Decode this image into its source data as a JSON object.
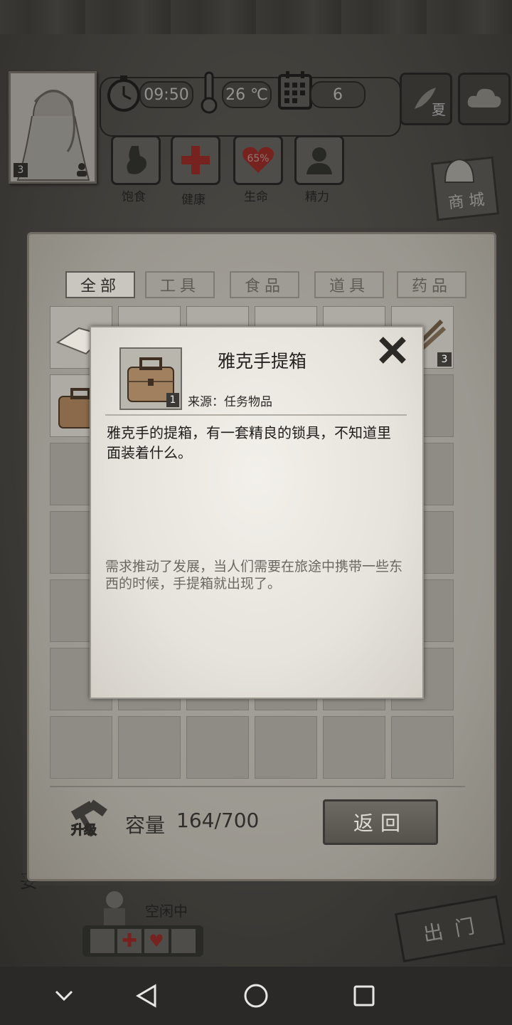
{
  "hud": {
    "time": "09:50",
    "temperature": "26 ℃",
    "day": "6",
    "season": "夏",
    "character_level": "3"
  },
  "stats": [
    {
      "label": "饱食"
    },
    {
      "label": "健康"
    },
    {
      "label": "生命",
      "value": "65%"
    },
    {
      "label": "精力"
    }
  ],
  "shop_label": "商 城",
  "inventory": {
    "tabs": [
      "全部",
      "工具",
      "食品",
      "道具",
      "药品"
    ],
    "active_tab": 0,
    "slot_count_badge": "3",
    "capacity_label": "容量",
    "capacity_value": "164/700",
    "upgrade_label": "升级",
    "return_label": "返回"
  },
  "item_dialog": {
    "title": "雅克手提箱",
    "quantity": "1",
    "source": "来源：任务物品",
    "description": "雅克手的提箱，有一套精良的锁具，不知道里面装着什么。",
    "flavor": "需求推动了发展，当人们需要在旅途中携带一些东西的时候，手提箱就出现了。"
  },
  "background": {
    "partial_text": "妥",
    "companion_status": "空闲中",
    "exit_label": "出 门"
  },
  "colors": {
    "dialog_paper": "#ebe8e1",
    "panel_paper": "#9f9c95",
    "health_red": "#b8322c"
  }
}
